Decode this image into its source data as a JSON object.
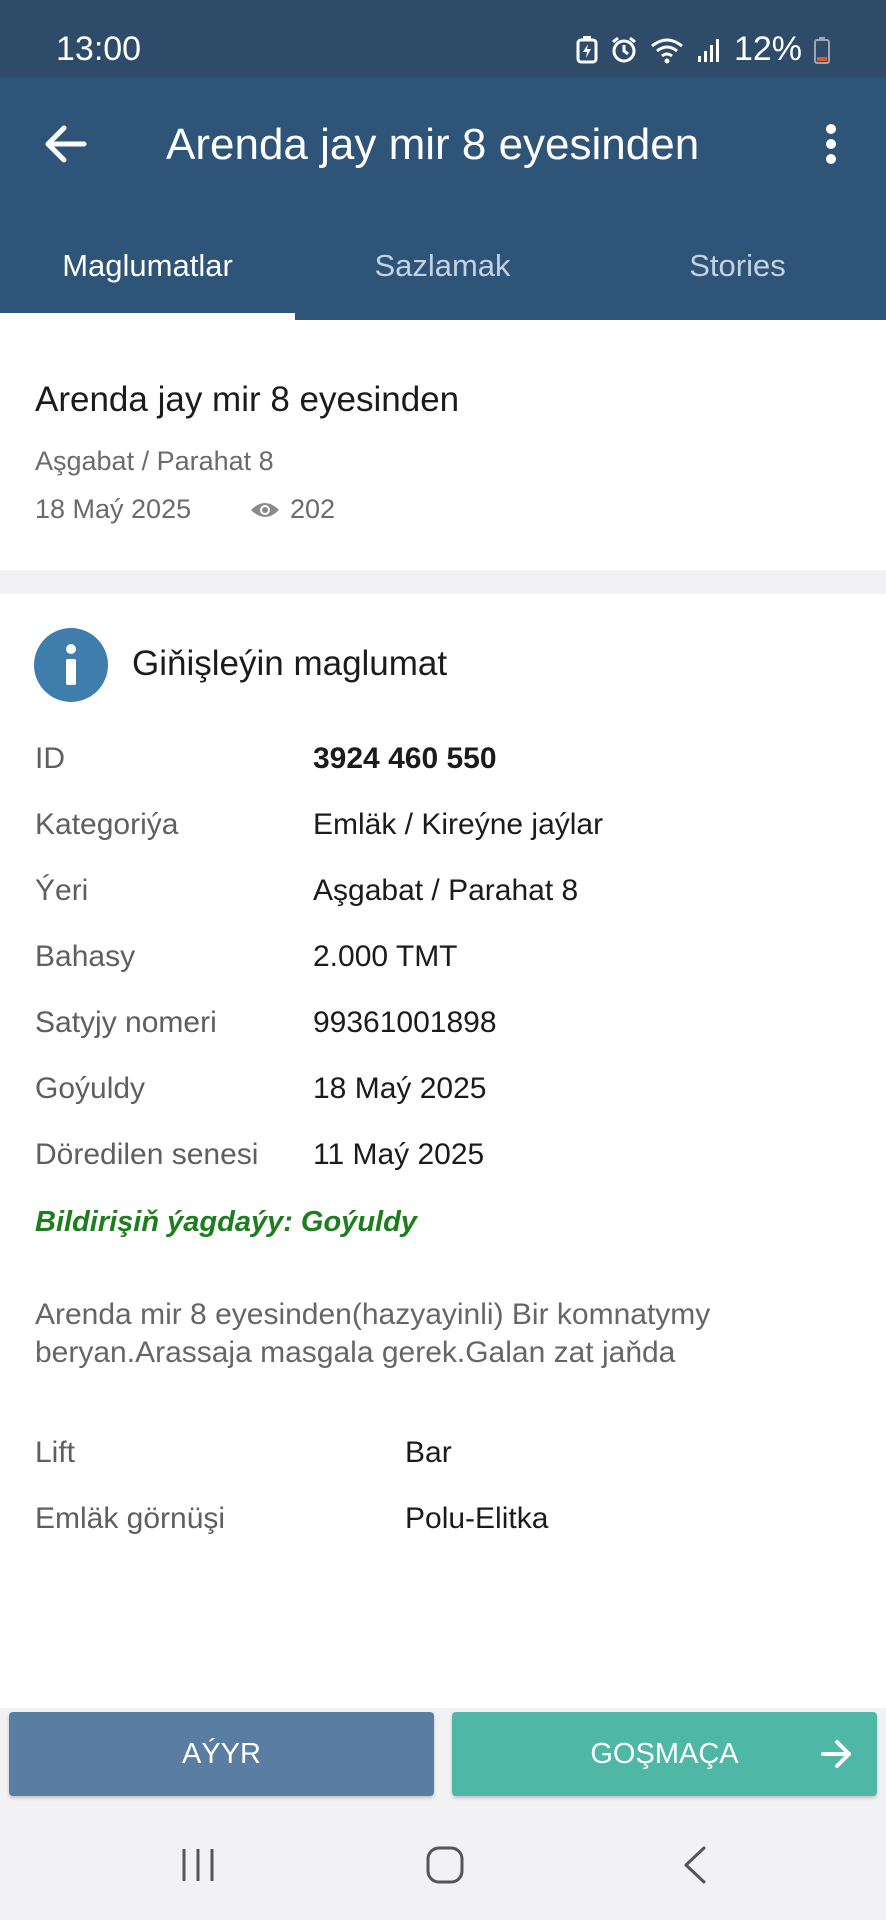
{
  "status_bar": {
    "time": "13:00",
    "battery": "12%"
  },
  "app_bar": {
    "title": "Arenda jay mir 8 eyesinden"
  },
  "tabs": [
    {
      "label": "Maglumatlar",
      "active": true
    },
    {
      "label": "Sazlamak",
      "active": false
    },
    {
      "label": "Stories",
      "active": false
    }
  ],
  "listing": {
    "title": "Arenda jay mir 8 eyesinden",
    "location": "Aşgabat / Parahat 8",
    "date": "18 Maý 2025",
    "views": "202"
  },
  "details": {
    "section_title": "Giňişleýin maglumat",
    "rows": [
      {
        "label": "ID",
        "value": "3924 460 550"
      },
      {
        "label": "Kategoriýa",
        "value": "Emläk / Kireýne jaýlar"
      },
      {
        "label": "Ýeri",
        "value": "Aşgabat / Parahat 8"
      },
      {
        "label": "Bahasy",
        "value": "2.000 TMT"
      },
      {
        "label": "Satyjy nomeri",
        "value": "99361001898"
      },
      {
        "label": "Goýuldy",
        "value": "18 Maý 2025"
      },
      {
        "label": "Döredilen senesi",
        "value": "11 Maý 2025"
      }
    ],
    "status": "Bildirişiň ýagdaýy: Goýuldy",
    "description": "Arenda mir 8 eyesinden(hazyayinli) Bir komnatymy beryan.Arassaja masgala gerek.Galan zat jaňda",
    "attributes": [
      {
        "label": "Lift",
        "value": "Bar"
      },
      {
        "label": "Emläk görnüşi",
        "value": "Polu-Elitka"
      }
    ]
  },
  "actions": {
    "remove_label": "AÝYR",
    "add_label": "GOŞMAÇA"
  },
  "colors": {
    "app_bar": "#2e5477",
    "status_bar": "#2e4b69",
    "remove_button": "#5a7ea2",
    "add_button": "#4fb7a5",
    "status_text": "#1e7d1e",
    "info_icon": "#3f7dad"
  }
}
